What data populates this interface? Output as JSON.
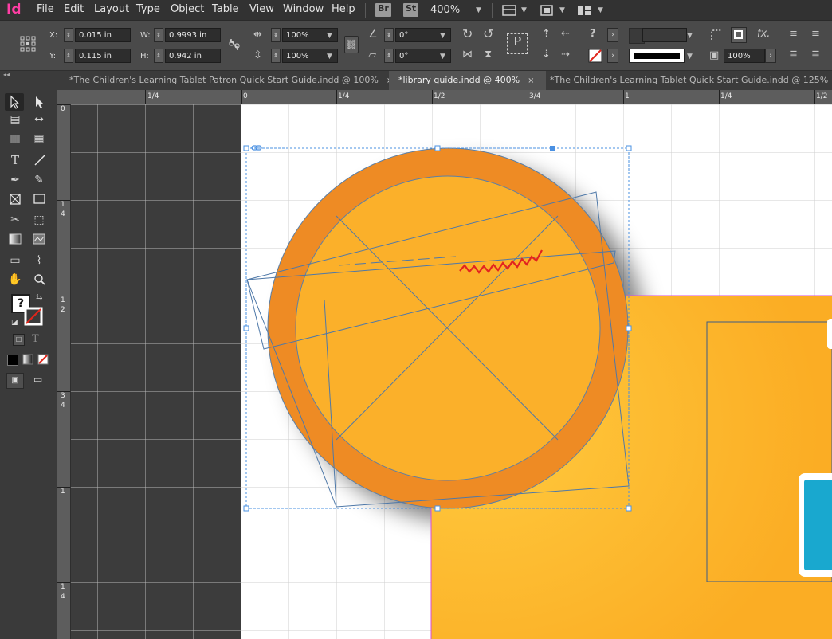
{
  "app": {
    "logo": "Id"
  },
  "menu": {
    "items": [
      "File",
      "Edit",
      "Layout",
      "Type",
      "Object",
      "Table",
      "View",
      "Window",
      "Help"
    ]
  },
  "menubar_extras": {
    "bridge": "Br",
    "stock": "St",
    "zoom": "400%"
  },
  "control": {
    "x_label": "X:",
    "x_value": "0.015 in",
    "y_label": "Y:",
    "y_value": "0.115 in",
    "w_label": "W:",
    "w_value": "0.9993 in",
    "h_label": "H:",
    "h_value": "0.942 in",
    "scale_x": "100%",
    "scale_y": "100%",
    "rotation": "0°",
    "shear": "0°",
    "stroke_weight_placeholder": "",
    "opacity": "100%",
    "question_mark": "?",
    "fx_label": "fx.",
    "p_label": "P"
  },
  "tabs": [
    {
      "label": "*The Children's Learning Tablet Patron Quick Start Guide.indd @ 100%",
      "close": "×",
      "active": false
    },
    {
      "label": "*library guide.indd @ 400%",
      "close": "×",
      "active": true
    },
    {
      "label": "*The Children's Learning Tablet Quick Start Guide.indd @ 125%",
      "close": "×",
      "active": false
    }
  ],
  "tools": {
    "selection": "selection-tool-icon",
    "direct": "direct-selection-tool-icon",
    "question": "?",
    "type_letter": "T",
    "formatting_letter": "T"
  },
  "ruler_top": {
    "labels": [
      "1/4",
      "0",
      "1/4",
      "1/2",
      "3/4",
      "1",
      "1/4",
      "1/2"
    ]
  },
  "ruler_left": {
    "labels": [
      [
        "0"
      ],
      [
        "1",
        "4"
      ],
      [
        "1",
        "2"
      ],
      [
        "3",
        "4"
      ],
      [
        "1"
      ],
      [
        "1",
        "4"
      ]
    ]
  },
  "colors": {
    "canvas_dark": "#3c3c3c",
    "page_white": "#ffffff",
    "grid": "#cfcfcf",
    "orange_ring": "#ee8b24",
    "orange_fill": "#fbb02a",
    "page_orange": "#fbb02a",
    "selection": "#4a90e2",
    "margin": "#d64ed8",
    "frame_blue": "#5b7fa6",
    "zigzag": "#e22420",
    "cyan": "#19a8cf"
  }
}
